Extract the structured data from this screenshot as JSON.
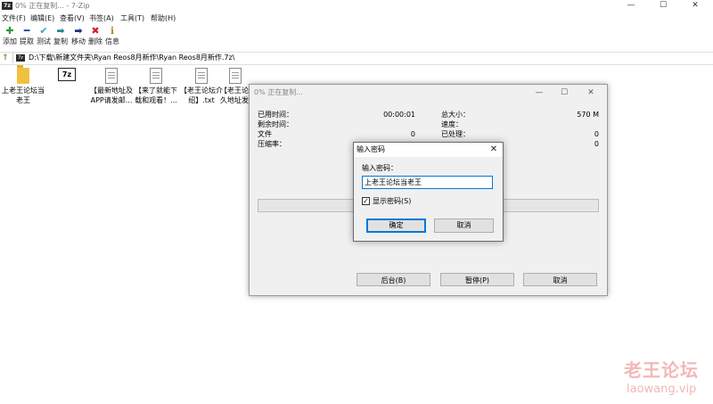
{
  "window": {
    "app_icon": "7z",
    "title": "0% 正在复制... - 7-Zip",
    "minimize_glyph": "—",
    "maximize_glyph": "☐",
    "close_glyph": "✕"
  },
  "menu": [
    "文件(F)",
    "编辑(E)",
    "查看(V)",
    "书签(A)",
    "工具(T)",
    "帮助(H)"
  ],
  "toolbar": [
    {
      "label": "添加",
      "icon": "add-plus-icon",
      "glyph": "✚",
      "color": "#2e9b2e"
    },
    {
      "label": "提取",
      "icon": "extract-minus-icon",
      "glyph": "━",
      "color": "#1f3fa8"
    },
    {
      "label": "测试",
      "icon": "test-check-icon",
      "glyph": "✔",
      "color": "#2aa7c7"
    },
    {
      "label": "复制",
      "icon": "copy-arrow-icon",
      "glyph": "➡",
      "color": "#1f8a8a"
    },
    {
      "label": "移动",
      "icon": "move-arrow-icon",
      "glyph": "➡",
      "color": "#1f2f8a"
    },
    {
      "label": "删除",
      "icon": "delete-x-icon",
      "glyph": "✖",
      "color": "#d02020"
    },
    {
      "label": "信息",
      "icon": "info-icon",
      "glyph": "ℹ",
      "color": "#b08a10"
    }
  ],
  "address": {
    "path": "D:\\下载\\新建文件夹\\Ryan Reos8月新作\\Ryan Reos8月新作.7z\\",
    "path_icon": "7z"
  },
  "files": [
    {
      "name_line1": "上老王论坛当",
      "name_line2": "老王",
      "kind": "folder"
    },
    {
      "name_line1": "",
      "name_line2": "",
      "kind": "7z",
      "icon_text": "7z"
    },
    {
      "name_line1": "【最新地址及",
      "name_line2": "APP请发邮...",
      "kind": "doc"
    },
    {
      "name_line1": "【来了就能下",
      "name_line2": "载和观看！...",
      "kind": "doc"
    },
    {
      "name_line1": "【老王论坛介",
      "name_line2": "绍】.txt",
      "kind": "doc"
    },
    {
      "name_line1": "【老王论",
      "name_line2": "久地址发...",
      "kind": "doc"
    }
  ],
  "progress": {
    "title": "0% 正在复制...",
    "elapsed_label": "已用时间：",
    "elapsed_value": "00:00:01",
    "remaining_label": "剩余时间：",
    "files_label": "文件",
    "files_value": "0",
    "ratio_label": "压缩率：",
    "total_label": "总大小：",
    "total_value": "570 M",
    "speed_label": "速度：",
    "processed_label": "已处理：",
    "processed_value": "0",
    "packed_value": "0",
    "background_btn": "后台(B)",
    "pause_btn": "暂停(P)",
    "cancel_btn": "取消"
  },
  "password": {
    "title": "输入密码",
    "close_glyph": "✕",
    "label": "输入密码：",
    "value": "上老王论坛当老王",
    "show_checked_glyph": "✓",
    "show_label": "显示密码(S)",
    "ok": "确定",
    "cancel": "取消"
  },
  "watermark": {
    "cn": "老王论坛",
    "en": "laowang.vip"
  }
}
